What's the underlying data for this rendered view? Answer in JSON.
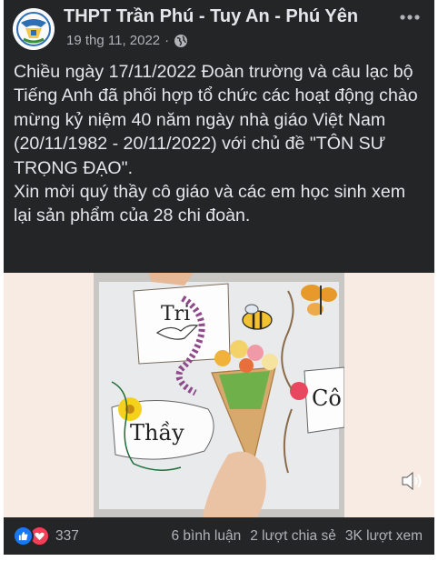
{
  "post": {
    "page_name": "THPT Trần Phú - Tuy An - Phú Yên",
    "date": "19 thg 11, 2022",
    "separator": "·",
    "privacy_icon": "globe-icon",
    "more_icon": "more-dots-icon",
    "caption": "Chiều ngày 17/11/2022 Đoàn trường và câu lạc bộ Tiếng Anh đã phối hợp tổ chức các hoạt động chào mừng kỷ niệm 40 năm ngày nhà giáo Việt Nam (20/11/1982 - 20/11/2022) với chủ đề \"TÔN SƯ TRỌNG ĐẠO\".\nXin mời quý thầy cô giáo và các em học sinh xem lại sản phẩm của 28 chi đoàn."
  },
  "video": {
    "card_text_left": "Thầy",
    "card_text_right": "Cô",
    "card_text_top": "Tri",
    "volume_icon": "speaker-icon"
  },
  "stats": {
    "reaction_icons": [
      "like-icon",
      "love-icon"
    ],
    "reaction_count": "337",
    "comments": "6 bình luận",
    "shares": "2 lượt chia sẻ",
    "views": "3K lượt xem"
  },
  "colors": {
    "background": "#242526",
    "text": "#e4e6eb",
    "secondary_text": "#b0b3b8",
    "like": "#1877f2",
    "love": "#f33e58",
    "media_background": "#f7ebe3"
  }
}
